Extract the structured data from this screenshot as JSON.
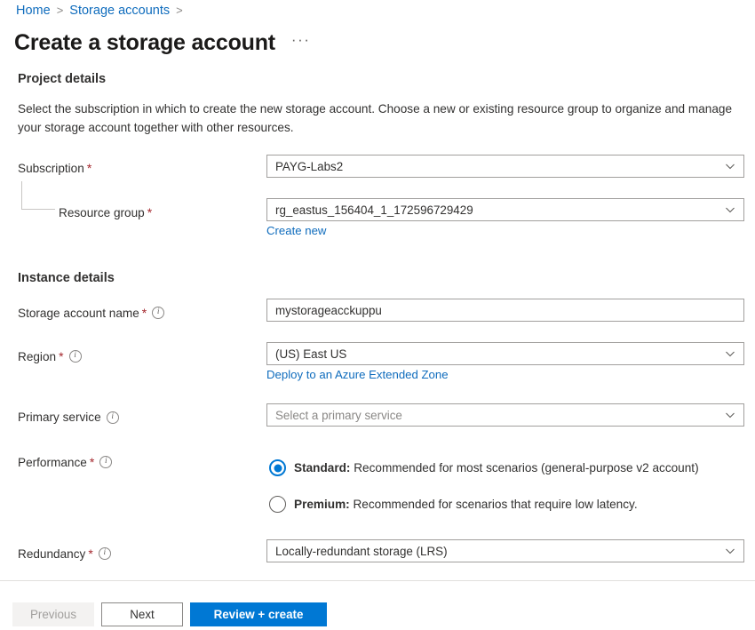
{
  "breadcrumb": {
    "items": [
      "Home",
      "Storage accounts"
    ],
    "separator": ">"
  },
  "header": {
    "title": "Create a storage account",
    "ellipsis": "···"
  },
  "project_details": {
    "heading": "Project details",
    "description": "Select the subscription in which to create the new storage account. Choose a new or existing resource group to organize and manage your storage account together with other resources.",
    "subscription": {
      "label": "Subscription",
      "required": "*",
      "value": "PAYG-Labs2"
    },
    "resource_group": {
      "label": "Resource group",
      "required": "*",
      "value": "rg_eastus_156404_1_172596729429",
      "create_new_link": "Create new"
    }
  },
  "instance_details": {
    "heading": "Instance details",
    "storage_account_name": {
      "label": "Storage account name",
      "required": "*",
      "value": "mystorageacckuppu"
    },
    "region": {
      "label": "Region",
      "required": "*",
      "value": "(US) East US",
      "extended_zone_link": "Deploy to an Azure Extended Zone"
    },
    "primary_service": {
      "label": "Primary service",
      "placeholder": "Select a primary service",
      "value": "Select a primary service"
    },
    "performance": {
      "label": "Performance",
      "required": "*",
      "selected": "Standard",
      "options": [
        {
          "name": "Standard",
          "bold": "Standard:",
          "description": " Recommended for most scenarios (general-purpose v2 account)",
          "checked": true
        },
        {
          "name": "Premium",
          "bold": "Premium:",
          "description": " Recommended for scenarios that require low latency.",
          "checked": false
        }
      ]
    },
    "redundancy": {
      "label": "Redundancy",
      "required": "*",
      "value": "Locally-redundant storage (LRS)"
    }
  },
  "footer": {
    "previous": "Previous",
    "next": "Next",
    "review_create": "Review + create"
  },
  "colors": {
    "link": "#0f6cbd",
    "primary": "#0078d4",
    "required": "#a4262c",
    "border": "#a19f9d",
    "text": "#323130"
  }
}
